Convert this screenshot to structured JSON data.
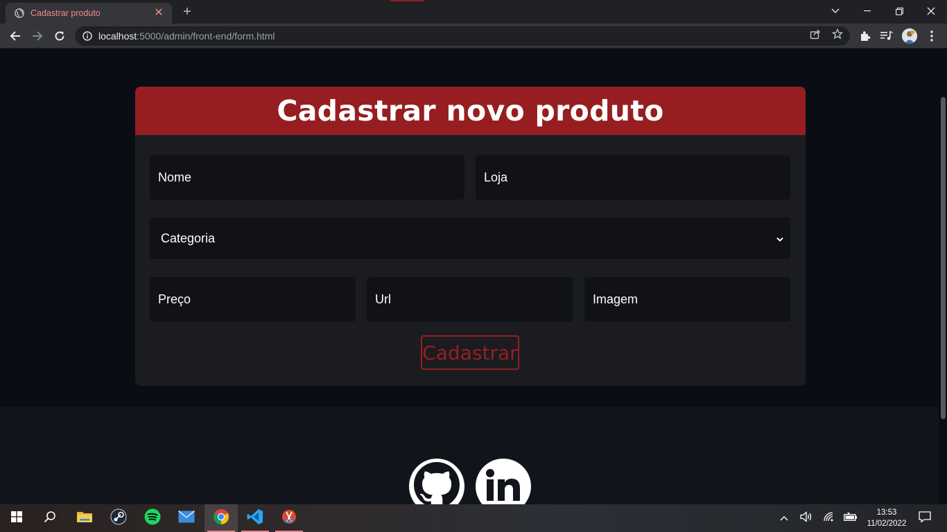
{
  "browser": {
    "tab_title": "Cadastrar produto",
    "url_host": "localhost",
    "url_path": ":5000/admin/front-end/form.html"
  },
  "form": {
    "title": "Cadastrar novo produto",
    "fields": {
      "nome": "Nome",
      "loja": "Loja",
      "categoria": "Categoria",
      "preco": "Preço",
      "url": "Url",
      "imagem": "Imagem"
    },
    "submit_label": "Cadastrar"
  },
  "taskbar": {
    "time": "13:53",
    "date": "11/02/2022"
  },
  "colors": {
    "accent": "#961e21",
    "card_bg": "#1b1c20",
    "page_bg": "#0a0d14",
    "input_bg": "#101216"
  }
}
